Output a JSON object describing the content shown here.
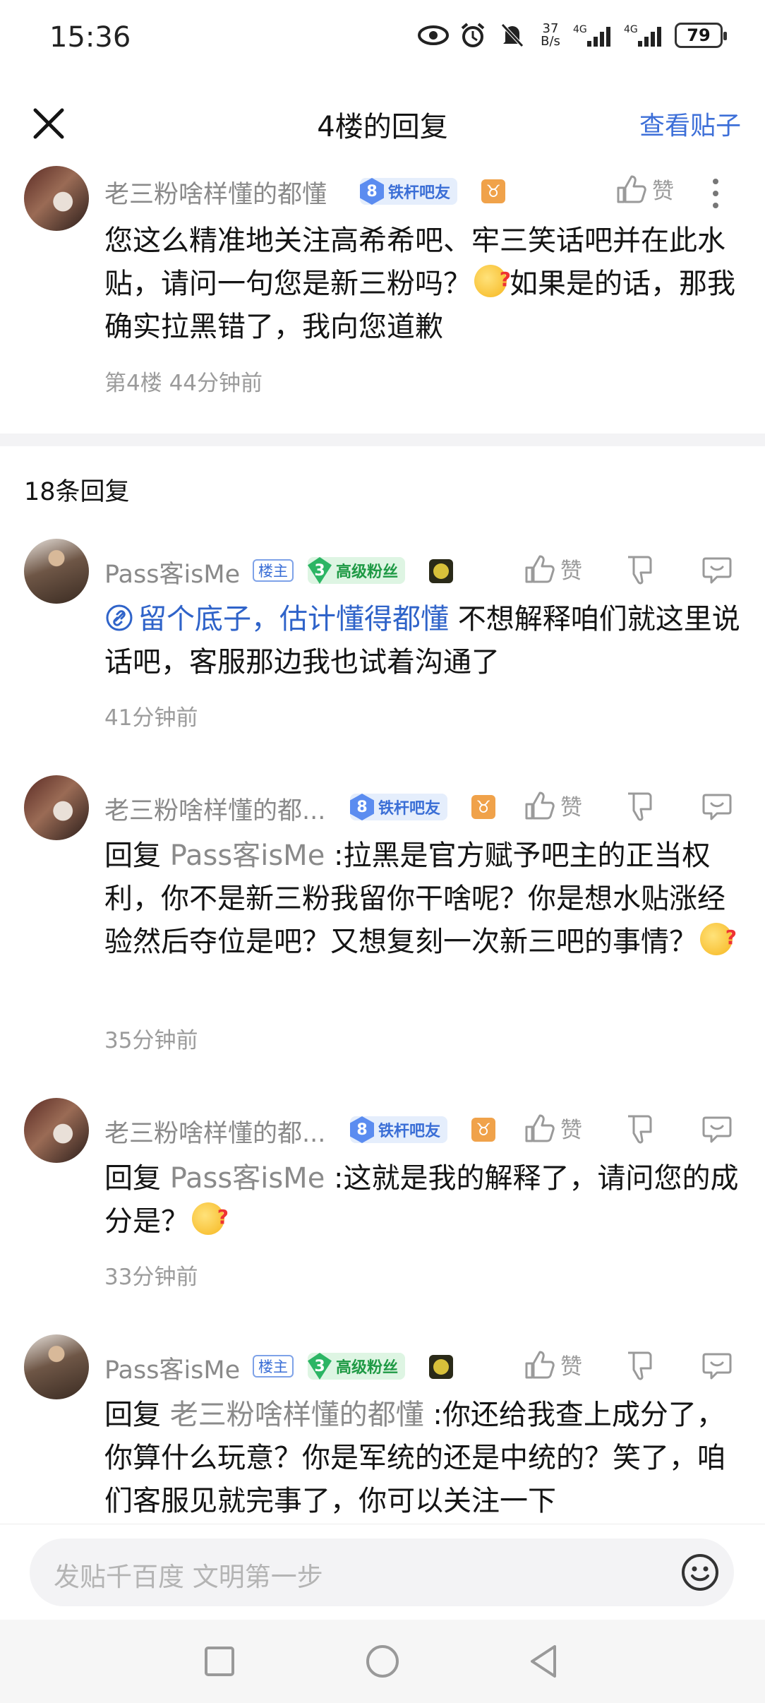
{
  "status_bar": {
    "time": "15:36",
    "net_speed": "37\nB/s",
    "signal1": "4G",
    "signal2": "4G",
    "battery": "79"
  },
  "header": {
    "title": "4楼的回复",
    "view_post": "查看贴子"
  },
  "floor_post": {
    "username": "老三粉啥样懂的都懂",
    "level": "8",
    "level_title": "铁杆吧友",
    "zodiac": "♉",
    "like_label": "赞",
    "content_part1": "您这么精准地关注高希希吧、牢三笑话吧并在此水贴，请问一句您是新三粉吗？",
    "content_part2": "如果是的话，那我确实拉黑错了，我向您道歉",
    "meta": "第4楼 44分钟前"
  },
  "reply_count": "18条回复",
  "replies": [
    {
      "username": "Pass客isMe",
      "host_badge": "楼主",
      "level": "3",
      "level_title": "高级粉丝",
      "like_label": "赞",
      "link_text": "留个底子，估计懂得都懂",
      "text": " 不想解释咱们就这里说话吧，客服那边我也试着沟通了",
      "time": "41分钟前"
    },
    {
      "username": "老三粉啥样懂的都...",
      "level": "8",
      "level_title": "铁杆吧友",
      "zodiac": "♉",
      "like_label": "赞",
      "reply_prefix": "回复 ",
      "reply_to": "Pass客isMe",
      "text": " :拉黑是官方赋予吧主的正当权利，你不是新三粉我留你干啥呢？你是想水贴涨经验然后夺位是吧？又想复刻一次新三吧的事情？",
      "time": "35分钟前"
    },
    {
      "username": "老三粉啥样懂的都...",
      "level": "8",
      "level_title": "铁杆吧友",
      "zodiac": "♉",
      "like_label": "赞",
      "reply_prefix": "回复 ",
      "reply_to": "Pass客isMe",
      "text": " :这就是我的解释了，请问您的成分是？",
      "time": "33分钟前"
    },
    {
      "username": "Pass客isMe",
      "host_badge": "楼主",
      "level": "3",
      "level_title": "高级粉丝",
      "like_label": "赞",
      "reply_prefix": "回复 ",
      "reply_to": "老三粉啥样懂的都懂",
      "text": " :你还给我查上成分了，你算什么玩意？你是军统的还是中统的？笑了，咱们客服见就完事了，你可以关注一下"
    }
  ],
  "input": {
    "placeholder": "发贴千百度 文明第一步"
  }
}
